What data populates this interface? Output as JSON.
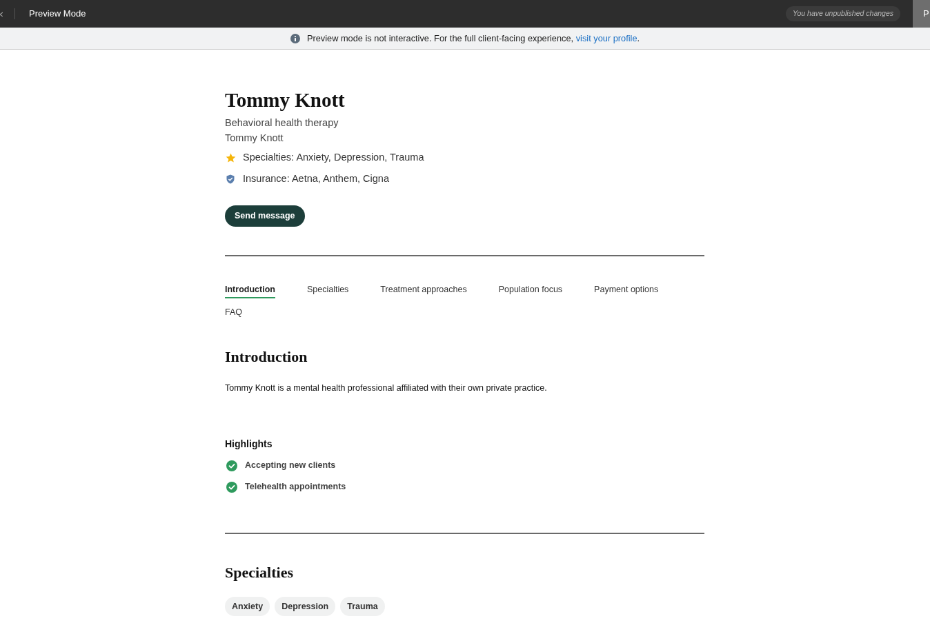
{
  "top_bar": {
    "title": "Preview Mode",
    "status": "You have unpublished changes",
    "button": "P"
  },
  "banner": {
    "text_before": "Preview mode is not interactive. For the full client-facing experience, ",
    "link": "visit your profile",
    "text_after": "."
  },
  "profile": {
    "name": "Tommy Knott",
    "subtitle": "Behavioral health therapy",
    "practitioner": "Tommy Knott",
    "facts": [
      {
        "kind": "specialties",
        "text": "Specialties: Anxiety, Depression, Trauma"
      },
      {
        "kind": "insurance",
        "text": "Insurance: Aetna, Anthem, Cigna"
      }
    ],
    "button": "Send message"
  },
  "tabs": [
    {
      "label": "Introduction",
      "selected": true
    },
    {
      "label": "Specialties",
      "selected": false
    },
    {
      "label": "Treatment approaches",
      "selected": false
    },
    {
      "label": "Population focus",
      "selected": false
    },
    {
      "label": "Payment options",
      "selected": false
    },
    {
      "label": "FAQ",
      "selected": false
    }
  ],
  "introduction": {
    "heading": "Introduction",
    "text": "Tommy Knott is a mental health professional affiliated with their own private practice.",
    "highlights_heading": "Highlights",
    "highlights": [
      "Accepting new clients",
      "Telehealth appointments"
    ]
  },
  "specialties": {
    "heading": "Specialties",
    "tags": [
      "Anxiety",
      "Depression",
      "Trauma"
    ]
  }
}
